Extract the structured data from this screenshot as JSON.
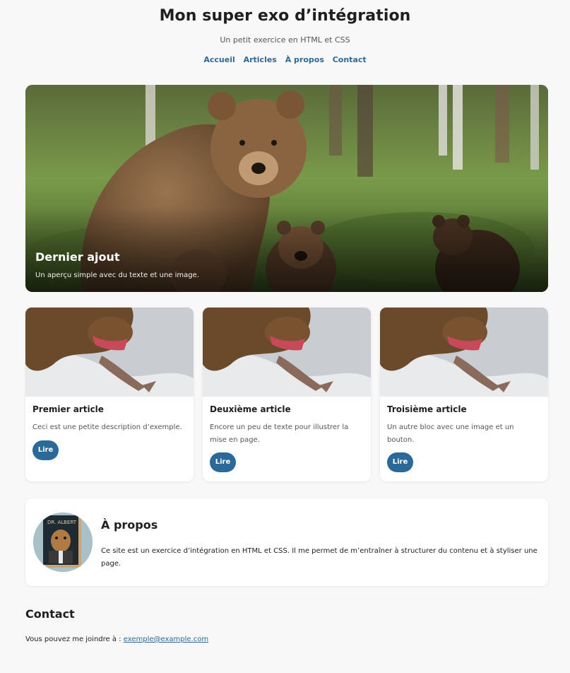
{
  "header": {
    "title": "Mon super exo d’intégration",
    "subtitle": "Un petit exercice en HTML et CSS",
    "nav": [
      {
        "label": "Accueil"
      },
      {
        "label": "Articles"
      },
      {
        "label": "À propos"
      },
      {
        "label": "Contact"
      }
    ]
  },
  "hero": {
    "title": "Dernier ajout",
    "text": "Un aperçu simple avec du texte et une image."
  },
  "articles": [
    {
      "title": "Premier article",
      "description": "Ceci est une petite description d’exemple.",
      "button": "Lire"
    },
    {
      "title": "Deuxième article",
      "description": "Encore un peu de texte pour illustrer la mise en page.",
      "button": "Lire"
    },
    {
      "title": "Troisième article",
      "description": "Un autre bloc avec une image et un bouton.",
      "button": "Lire"
    }
  ],
  "about": {
    "title": "À propos",
    "text": "Ce site est un exercice d’intégration en HTML et CSS. Il me permet de m’entraîner à structurer du contenu et à styliser une page.",
    "avatar_book_title": "DR. ALBERT"
  },
  "contact": {
    "title": "Contact",
    "text": "Vous pouvez me joindre à :",
    "email": "exemple@example.com"
  },
  "colors": {
    "accent": "#2b6a98",
    "background": "#f8f8f8",
    "card": "#ffffff"
  }
}
